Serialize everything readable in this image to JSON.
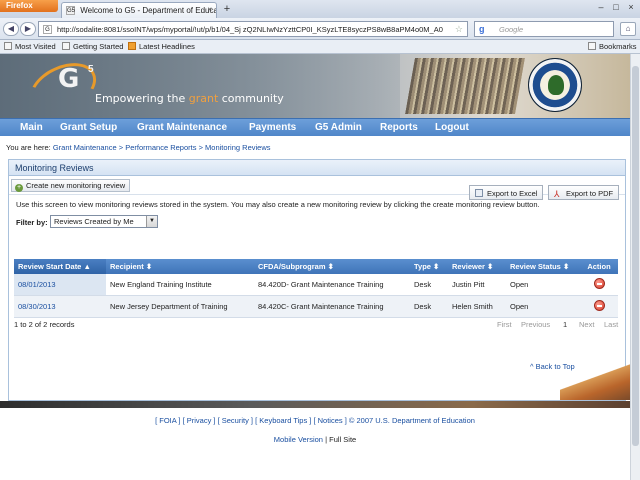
{
  "browser": {
    "app_button": "Firefox",
    "tab_title": "Welcome to G5 - Department of Educati...",
    "tab_favicon": "G5",
    "new_tab": "+",
    "url": "http://sodalite:8081/ssoINT/wps/myportal/!ut/p/b1/04_Sj zQ2NLIwNzYzttCP0I_KSyzLTE8syczPS8wB8aPM4o0M_A0",
    "search_placeholder": "Google",
    "bookmarks": [
      "Most Visited",
      "Getting Started",
      "Latest Headlines"
    ],
    "bookmarks_menu": "Bookmarks"
  },
  "banner": {
    "logo": "G",
    "logo_sup": "5",
    "tagline_pre": "Empowering the ",
    "tagline_accent": "grant",
    "tagline_post": " community"
  },
  "nav": [
    "Main",
    "Grant Setup",
    "Grant Maintenance",
    "Payments",
    "G5 Admin",
    "Reports",
    "Logout"
  ],
  "breadcrumb": {
    "prefix": "You are here: ",
    "items": [
      "Grant Maintenance",
      "Performance Reports",
      "Monitoring Reviews"
    ],
    "sep": " > "
  },
  "panel": {
    "title": "Monitoring Reviews",
    "create_button": "Create new monitoring review",
    "description": "Use this screen to view monitoring reviews stored in the system. You may also create a new monitoring review by clicking the create monitoring review button.",
    "filter_label": "Filter by:",
    "filter_value": "Reviews Created by Me",
    "export_excel": "Export to Excel",
    "export_pdf": "Export to PDF"
  },
  "table": {
    "headers": [
      "Review Start Date",
      "Recipient",
      "CFDA/Subprogram",
      "Type",
      "Reviewer",
      "Review Status",
      "Action"
    ],
    "rows": [
      [
        "08/01/2013",
        "New England Training Institute",
        "84.420D- Grant Maintenance Training",
        "Desk",
        "Justin Pitt",
        "Open"
      ],
      [
        "08/30/2013",
        "New Jersey Department of Training",
        "84.420C- Grant Maintenance Training",
        "Desk",
        "Helen Smith",
        "Open"
      ]
    ],
    "record_count": "1 to 2 of 2 records",
    "pager": {
      "first": "First",
      "previous": "Previous",
      "current": "1",
      "next": "Next",
      "last": "Last"
    }
  },
  "footer": {
    "back_to_top": "^ Back to Top",
    "links": "[ FOIA ] [ Privacy ] [ Security ] [ Keyboard Tips ] [ Notices ] © 2007 U.S. Department of Education",
    "mobile": "Mobile Version",
    "sep": " | ",
    "full": "Full Site"
  },
  "colors": {
    "nav_blue": "#4f86c9",
    "table_header": "#3f74b8",
    "link": "#1a4fa0",
    "accent_orange": "#f0a040"
  }
}
